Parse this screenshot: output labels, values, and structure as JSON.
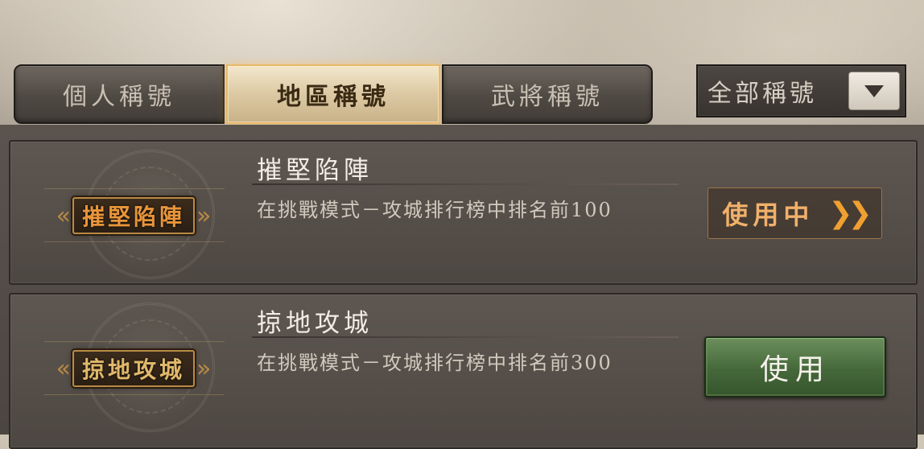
{
  "tabs": [
    {
      "label": "個人稱號",
      "active": false
    },
    {
      "label": "地區稱號",
      "active": true
    },
    {
      "label": "武將稱號",
      "active": false
    }
  ],
  "filter": {
    "label": "全部稱號",
    "icon": "triangle-down-icon"
  },
  "titles": [
    {
      "badge": "摧堅陷陣",
      "name": "摧堅陷陣",
      "description": "在挑戰模式－攻城排行榜中排名前100",
      "action": "使用中",
      "action_state": "in-use"
    },
    {
      "badge": "掠地攻城",
      "name": "掠地攻城",
      "description": "在挑戰模式－攻城排行榜中排名前300",
      "action": "使用",
      "action_state": "use"
    }
  ],
  "colors": {
    "active_tab": "#dcc9a3",
    "use_button": "#45683a",
    "in_use_text": "#f1b06a"
  }
}
